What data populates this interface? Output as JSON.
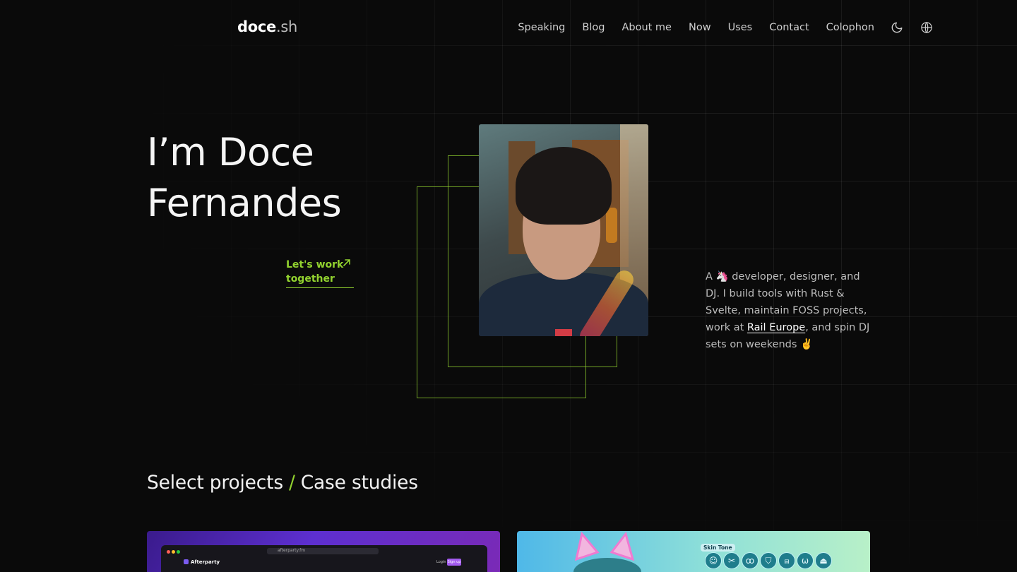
{
  "header": {
    "brand_main": "doce",
    "brand_suffix": ".sh",
    "nav": [
      "Speaking",
      "Blog",
      "About me",
      "Now",
      "Uses",
      "Contact",
      "Colophon"
    ],
    "theme_icon": "moon-icon",
    "language_icon": "globe-icon"
  },
  "hero": {
    "title_line1": "I’m Doce",
    "title_line2": "Fernandes",
    "cta": "Let's work together",
    "cta_icon": "arrow-up-right-icon",
    "photo_alt": "Portrait of Doce Fernandes"
  },
  "bio": {
    "prefix": "A",
    "emoji1": "🦄",
    "text1": " developer, designer, and DJ. I build tools with Rust & Svelte, maintain FOSS projects, work at ",
    "link": "Rail Europe",
    "text2": ", and spin DJ sets on weekends ",
    "emoji2": "✌️"
  },
  "projects": {
    "title_a": "Select projects",
    "separator": "/",
    "title_b": "Case studies",
    "card1": {
      "app_name": "Afterparty",
      "url": "afterparty.fm",
      "login": "Login",
      "signup": "Sign up"
    },
    "card2": {
      "skin_tone_label": "Skin Tone",
      "tool_icons": [
        "☺",
        "✂",
        "ꝏ",
        "⛉",
        "⩎",
        "ω",
        "⏏"
      ]
    }
  },
  "colors": {
    "accent": "#92d22f",
    "background": "#0a0a0a",
    "text": "#eaeaea"
  }
}
